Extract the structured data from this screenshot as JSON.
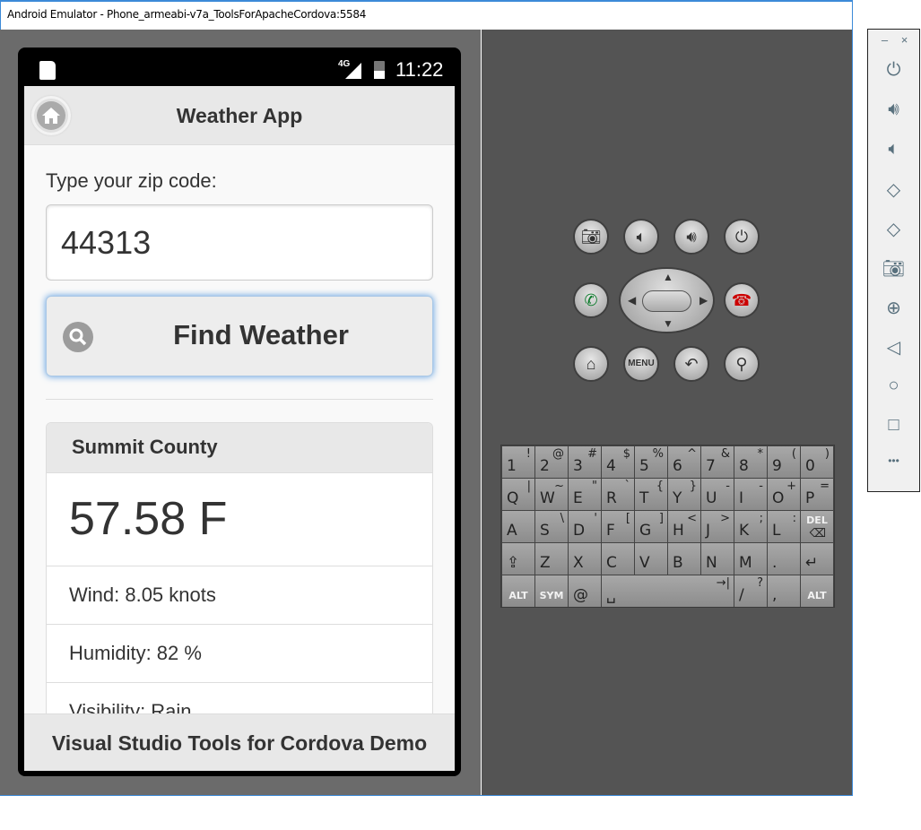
{
  "window": {
    "title": "Android Emulator - Phone_armeabi-v7a_ToolsForApacheCordova:5584"
  },
  "status_bar": {
    "network": "4G",
    "time": "11:22"
  },
  "app": {
    "title": "Weather App",
    "zip_label": "Type your zip code:",
    "zip_value": "44313",
    "find_button": "Find Weather",
    "county": "Summit County",
    "temperature": "57.58 F",
    "wind": "Wind: 8.05 knots",
    "humidity": "Humidity: 82 %",
    "visibility": "Visibility: Rain",
    "footer": "Visual Studio Tools for Cordova Demo"
  },
  "hw_buttons": {
    "menu": "MENU"
  },
  "keyboard": [
    [
      [
        "1",
        "!"
      ],
      [
        "2",
        "@"
      ],
      [
        "3",
        "#"
      ],
      [
        "4",
        "$"
      ],
      [
        "5",
        "%"
      ],
      [
        "6",
        "^"
      ],
      [
        "7",
        "&"
      ],
      [
        "8",
        "*"
      ],
      [
        "9",
        "("
      ],
      [
        "0",
        ")"
      ]
    ],
    [
      [
        "Q",
        "|"
      ],
      [
        "W",
        "~"
      ],
      [
        "E",
        "\""
      ],
      [
        "R",
        "`"
      ],
      [
        "T",
        "{"
      ],
      [
        "Y",
        "}"
      ],
      [
        "U",
        "-"
      ],
      [
        "I",
        "-"
      ],
      [
        "O",
        "+"
      ],
      [
        "P",
        "="
      ]
    ],
    [
      [
        "A",
        ""
      ],
      [
        "S",
        "\\"
      ],
      [
        "D",
        "'"
      ],
      [
        "F",
        "["
      ],
      [
        "G",
        "]"
      ],
      [
        "H",
        "<"
      ],
      [
        "J",
        ">"
      ],
      [
        "K",
        ";"
      ],
      [
        "L",
        ":"
      ],
      [
        "DEL",
        "⌫"
      ]
    ],
    [
      [
        "⇪",
        ""
      ],
      [
        "Z",
        ""
      ],
      [
        "X",
        ""
      ],
      [
        "C",
        ""
      ],
      [
        "V",
        ""
      ],
      [
        "B",
        ""
      ],
      [
        "N",
        ""
      ],
      [
        "M",
        ""
      ],
      [
        ".",
        ""
      ],
      [
        "↵",
        ""
      ]
    ],
    [
      [
        "ALT",
        ""
      ],
      [
        "SYM",
        ""
      ],
      [
        "@",
        ""
      ],
      [
        "␣",
        "→|"
      ],
      [
        "/",
        "?"
      ],
      [
        ",",
        ""
      ],
      [
        "ALT",
        ""
      ]
    ]
  ],
  "toolbar": {
    "minimize": "–",
    "close": "×",
    "more": "•••"
  }
}
